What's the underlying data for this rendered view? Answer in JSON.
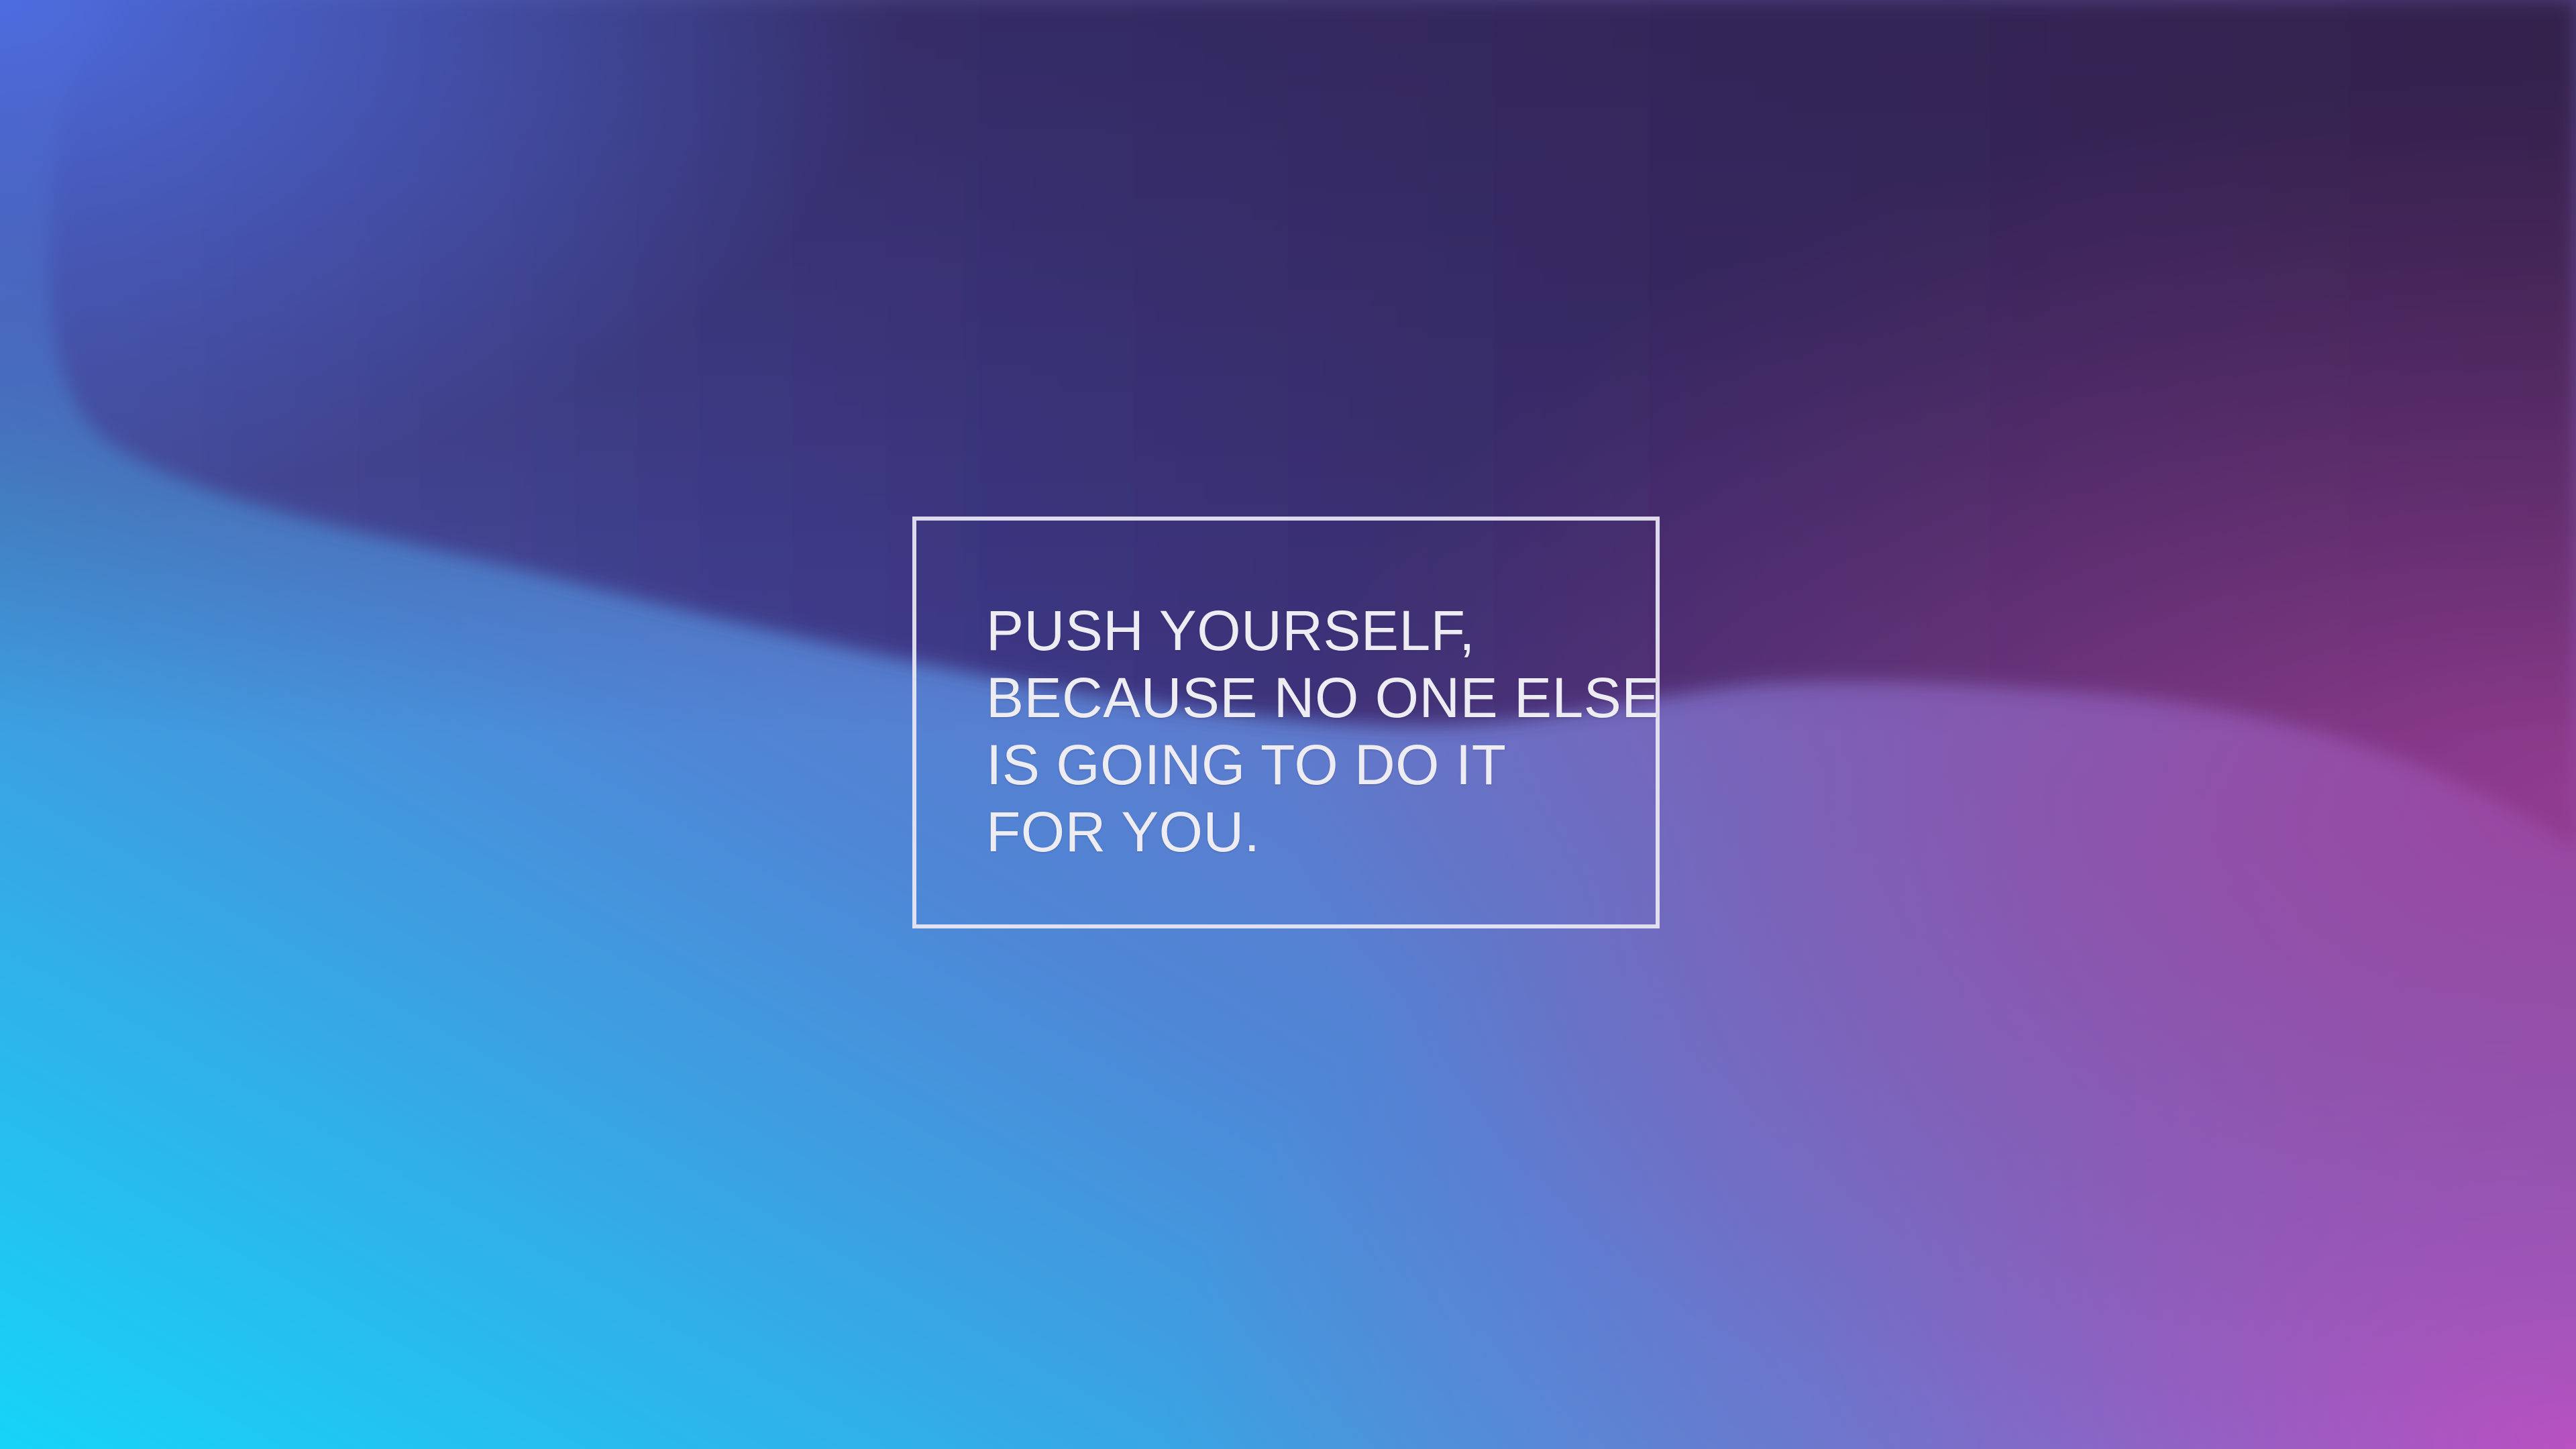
{
  "quote": {
    "lines": [
      "PUSH YOURSELF,",
      "BECAUSE NO ONE ELSE",
      "IS GOING TO DO IT",
      "FOR YOU."
    ]
  },
  "colors": {
    "text": "#eeecf3",
    "frame": "#ece8f6",
    "background_top_left": "#4c6be0",
    "background_top_right": "#341a3c",
    "background_bottom_left": "#16d2f6",
    "background_bottom_right": "#be54c4",
    "wave_light": "#7a6fc4"
  }
}
